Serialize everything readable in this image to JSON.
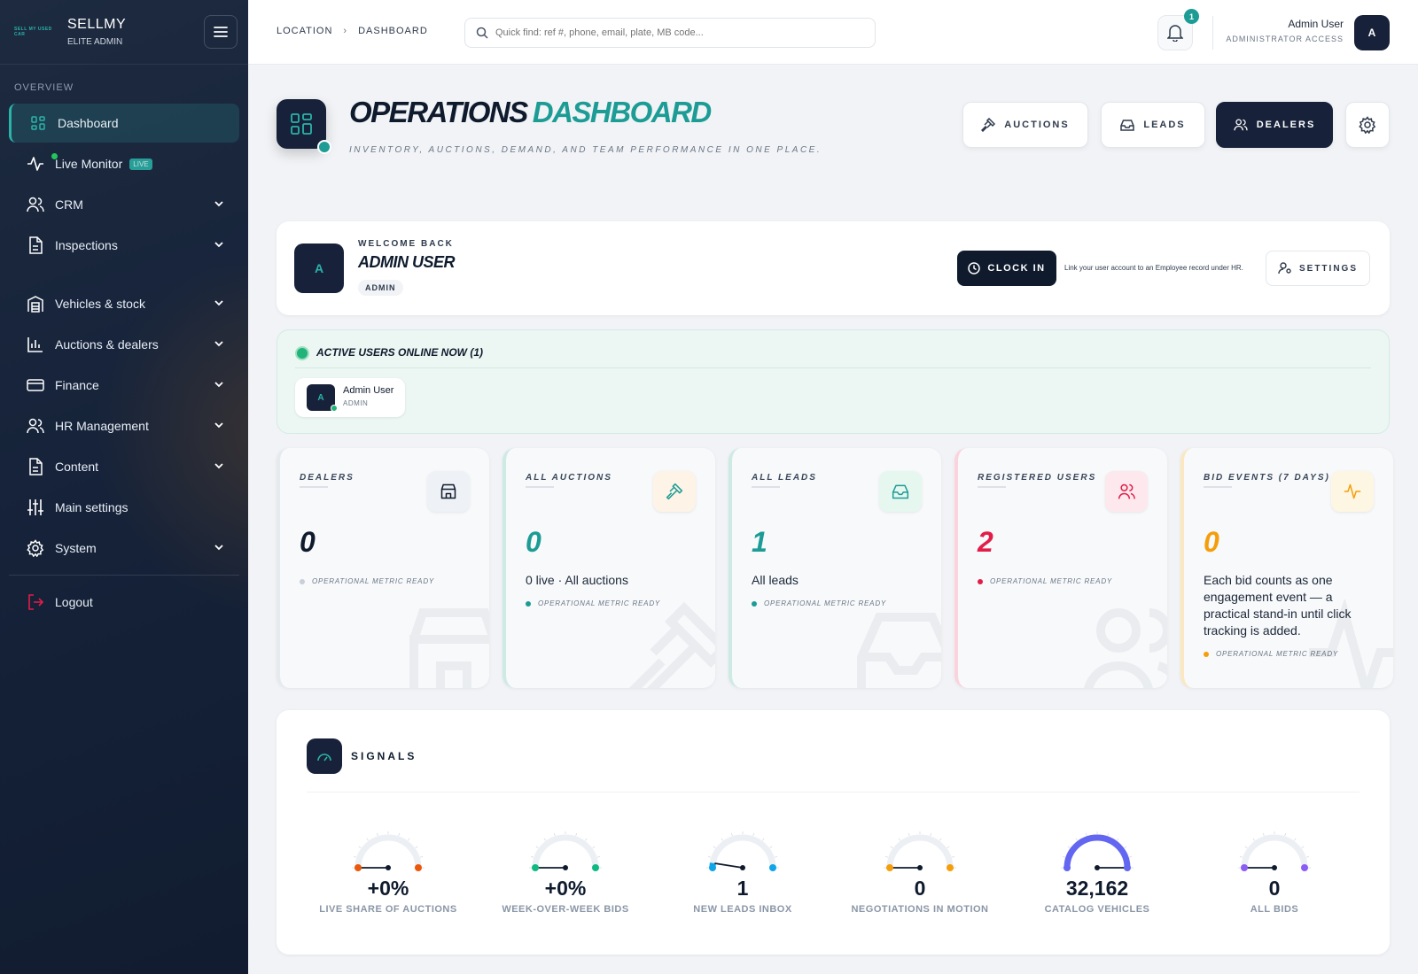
{
  "brand": {
    "logo_text": "SELL MY USED CAR",
    "name": "SELLMY",
    "subtitle": "ELITE ADMIN"
  },
  "sidebar": {
    "section": "OVERVIEW",
    "items": [
      {
        "label": "Dashboard",
        "icon": "grid-icon"
      },
      {
        "label": "Live Monitor",
        "icon": "activity-icon",
        "badge": "LIVE"
      },
      {
        "label": "CRM",
        "icon": "users-icon"
      },
      {
        "label": "Inspections",
        "icon": "document-icon"
      },
      {
        "label": "Vehicles & stock",
        "icon": "building-icon"
      },
      {
        "label": "Auctions & dealers",
        "icon": "bar-chart-icon"
      },
      {
        "label": "Finance",
        "icon": "credit-card-icon"
      },
      {
        "label": "HR Management",
        "icon": "users-icon"
      },
      {
        "label": "Content",
        "icon": "document-icon"
      },
      {
        "label": "Main settings",
        "icon": "sliders-icon"
      },
      {
        "label": "System",
        "icon": "gear-icon"
      }
    ],
    "logout": "Logout"
  },
  "topbar": {
    "breadcrumb": [
      "LOCATION",
      "DASHBOARD"
    ],
    "search_placeholder": "Quick find: ref #, phone, email, plate, MB code...",
    "notifications": "1",
    "user_name": "Admin User",
    "user_role": "ADMINISTRATOR ACCESS",
    "avatar": "A"
  },
  "header": {
    "title_part1": "OPERATIONS",
    "title_part2": "DASHBOARD",
    "subtitle": "INVENTORY, AUCTIONS, DEMAND, AND TEAM PERFORMANCE IN ONE PLACE.",
    "buttons": [
      "AUCTIONS",
      "LEADS",
      "DEALERS"
    ]
  },
  "welcome": {
    "label": "WELCOME BACK",
    "name": "ADMIN USER",
    "badge": "ADMIN",
    "avatar": "A",
    "clock_in": "CLOCK IN",
    "hint": "Link your user account to an Employee record under HR.",
    "settings": "SETTINGS"
  },
  "active_users": {
    "title": "ACTIVE USERS ONLINE NOW (1)",
    "users": [
      {
        "avatar": "A",
        "name": "Admin User",
        "role": "ADMIN"
      }
    ]
  },
  "metrics": [
    {
      "label": "DEALERS",
      "value": "0",
      "desc": "",
      "status": "OPERATIONAL METRIC READY",
      "color": "#0f1b2d",
      "accent": "#e6e9ee",
      "icon_bg": "#eef1f5",
      "icon": "store-icon"
    },
    {
      "label": "ALL AUCTIONS",
      "value": "0",
      "desc": "0 live · All auctions",
      "status": "OPERATIONAL METRIC READY",
      "color": "#1c9c95",
      "accent": "#cdeae5",
      "icon_bg": "#fdf3e7",
      "icon": "gavel-icon"
    },
    {
      "label": "ALL LEADS",
      "value": "1",
      "desc": "All leads",
      "status": "OPERATIONAL METRIC READY",
      "color": "#1c9c95",
      "accent": "#cdeae5",
      "icon_bg": "#e6f7f0",
      "icon": "inbox-icon"
    },
    {
      "label": "REGISTERED USERS",
      "value": "2",
      "desc": "",
      "status": "OPERATIONAL METRIC READY",
      "color": "#e11d48",
      "accent": "#fbd3dc",
      "icon_bg": "#fde8ed",
      "icon": "users-icon"
    },
    {
      "label": "BID EVENTS (7 DAYS)",
      "value": "0",
      "desc": "Each bid counts as one engagement event — a practical stand-in until click tracking is added.",
      "status": "OPERATIONAL METRIC READY",
      "color": "#f59e0b",
      "accent": "#fbe7c2",
      "icon_bg": "#fdf6e3",
      "icon": "activity-icon"
    }
  ],
  "signals": {
    "title": "SIGNALS",
    "gauges": [
      {
        "value": "+0%",
        "label": "LIVE SHARE OF AUCTIONS",
        "color": "#ea580c",
        "fill": 0
      },
      {
        "value": "+0%",
        "label": "WEEK-OVER-WEEK BIDS",
        "color": "#10b981",
        "fill": 0
      },
      {
        "value": "1",
        "label": "NEW LEADS INBOX",
        "color": "#0ea5e9",
        "fill": 0.05
      },
      {
        "value": "0",
        "label": "NEGOTIATIONS IN MOTION",
        "color": "#f59e0b",
        "fill": 0
      },
      {
        "value": "32,162",
        "label": "CATALOG VEHICLES",
        "color": "#6366f1",
        "fill": 1
      },
      {
        "value": "0",
        "label": "ALL BIDS",
        "color": "#8b5cf6",
        "fill": 0
      }
    ]
  }
}
